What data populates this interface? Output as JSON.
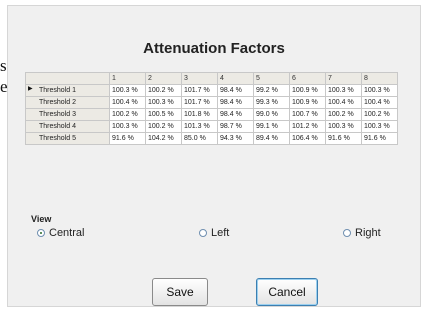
{
  "background_text": {
    "line1": "s",
    "line2": "e"
  },
  "dialog": {
    "title": "Attenuation Factors",
    "table": {
      "columns": [
        "1",
        "2",
        "3",
        "4",
        "5",
        "6",
        "7",
        "8"
      ],
      "rows": [
        {
          "label": "Threshold 1",
          "values": [
            "100.3 %",
            "100.2 %",
            "101.7 %",
            "98.4 %",
            "99.2 %",
            "100.9 %",
            "100.3 %",
            "100.3 %"
          ]
        },
        {
          "label": "Threshold 2",
          "values": [
            "100.4 %",
            "100.3 %",
            "101.7 %",
            "98.4 %",
            "99.3 %",
            "100.9 %",
            "100.4 %",
            "100.4 %"
          ]
        },
        {
          "label": "Threshold 3",
          "values": [
            "100.2 %",
            "100.5 %",
            "101.8 %",
            "98.4 %",
            "99.0 %",
            "100.7 %",
            "100.2 %",
            "100.2 %"
          ]
        },
        {
          "label": "Threshold 4",
          "values": [
            "100.3 %",
            "100.2 %",
            "101.3 %",
            "98.7 %",
            "99.1 %",
            "101.2 %",
            "100.3 %",
            "100.3 %"
          ]
        },
        {
          "label": "Threshold 5",
          "values": [
            "91.6 %",
            "104.2 %",
            "85.0 %",
            "94.3 %",
            "89.4 %",
            "106.4 %",
            "91.6 %",
            "91.6 %"
          ]
        }
      ]
    },
    "view": {
      "legend": "View",
      "options": [
        {
          "label": "Central",
          "selected": true
        },
        {
          "label": "Left",
          "selected": false
        },
        {
          "label": "Right",
          "selected": false
        }
      ]
    },
    "buttons": {
      "save": "Save",
      "cancel": "Cancel"
    }
  }
}
